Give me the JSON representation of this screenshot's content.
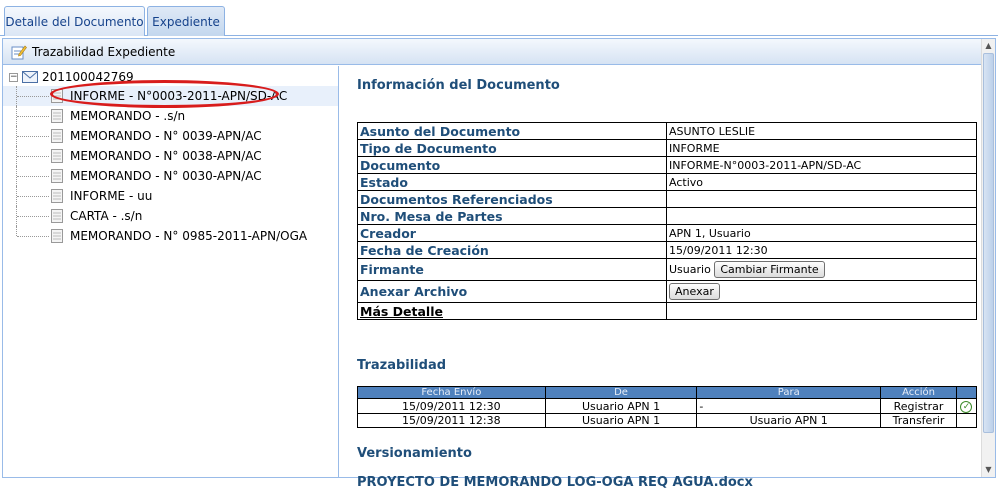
{
  "tabs": [
    {
      "label": "Detalle del Documento"
    },
    {
      "label": "Expediente"
    }
  ],
  "panel": {
    "title": "Trazabilidad Expediente"
  },
  "tree": {
    "root": "201100042769",
    "items": [
      {
        "label": "INFORME - N°0003-2011-APN/SD-AC",
        "selected": true
      },
      {
        "label": "MEMORANDO - .s/n"
      },
      {
        "label": "MEMORANDO - N° 0039-APN/AC"
      },
      {
        "label": "MEMORANDO - N° 0038-APN/AC"
      },
      {
        "label": "MEMORANDO - N° 0030-APN/AC"
      },
      {
        "label": "INFORME - uu"
      },
      {
        "label": "CARTA - .s/n"
      },
      {
        "label": "MEMORANDO - N° 0985-2011-APN/OGA"
      }
    ]
  },
  "info": {
    "title": "Información del Documento",
    "rows": [
      {
        "key": "Asunto del Documento",
        "value": "ASUNTO LESLIE"
      },
      {
        "key": "Tipo de Documento",
        "value": "INFORME"
      },
      {
        "key": "Documento",
        "value": "INFORME-N°0003-2011-APN/SD-AC"
      },
      {
        "key": "Estado",
        "value": "Activo"
      },
      {
        "key": "Documentos Referenciados",
        "value": ""
      },
      {
        "key": "Nro. Mesa de Partes",
        "value": ""
      },
      {
        "key": "Creador",
        "value": "APN 1, Usuario"
      },
      {
        "key": "Fecha de Creación",
        "value": "15/09/2011 12:30"
      }
    ],
    "firmante": {
      "key": "Firmante",
      "value": "Usuario",
      "button": "Cambiar Firmante"
    },
    "anexar": {
      "key": "Anexar Archivo",
      "button": "Anexar"
    },
    "mas_detalle": "Más Detalle"
  },
  "trazabilidad": {
    "title": "Trazabilidad",
    "headers": [
      "Fecha Envío",
      "De",
      "Para",
      "Acción"
    ],
    "rows": [
      {
        "fecha": "15/09/2011 12:30",
        "de": "Usuario APN 1",
        "para": "-",
        "accion": "Registrar"
      },
      {
        "fecha": "15/09/2011 12:38",
        "de": "Usuario APN 1",
        "para": "Usuario APN 1",
        "accion": "Transferir"
      }
    ]
  },
  "versionamiento": {
    "title": "Versionamiento",
    "file": "PROYECTO DE MEMORANDO LOG-OGA REQ AGUA.docx"
  }
}
